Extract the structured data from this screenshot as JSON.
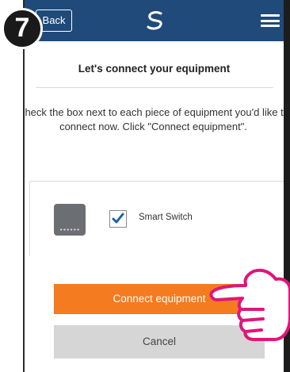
{
  "step_badge": "7",
  "header": {
    "back_label": "Back",
    "logo_icon": "swoosh-logo",
    "menu_icon": "hamburger-menu-icon",
    "bar_color": "#1f4a7a"
  },
  "title": "Let's connect your equipment",
  "instructions": "Check the box next to each piece of equipment you'd like to connect now. Click \"Connect equipment\".",
  "equipment": [
    {
      "label": "Smart Switch",
      "checked": true,
      "icon": "smart-switch-device-icon"
    }
  ],
  "buttons": {
    "connect_label": "Connect equipment",
    "connect_color": "#f47b20",
    "cancel_label": "Cancel",
    "cancel_color": "#d6d6d6"
  },
  "overlay": {
    "pointer_icon": "pointing-hand-icon",
    "color": "#e0157a"
  }
}
